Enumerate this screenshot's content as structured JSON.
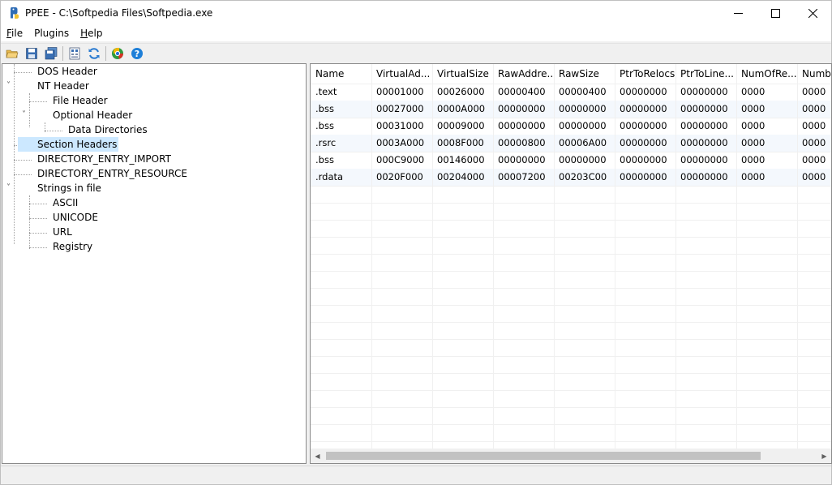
{
  "window": {
    "title": "PPEE - C:\\Softpedia Files\\Softpedia.exe",
    "controls": {
      "minimize": "minimize",
      "maximize": "maximize",
      "close": "close"
    }
  },
  "menu": [
    {
      "key": "F",
      "rest": "ile"
    },
    {
      "key": "",
      "rest": "Plugins"
    },
    {
      "key": "H",
      "rest": "elp"
    }
  ],
  "toolbar": {
    "buttons": [
      "open-folder-icon",
      "save-icon",
      "save-all-icon",
      "hex-view-icon",
      "refresh-icon",
      "plugins-icon",
      "help-icon"
    ]
  },
  "tree": {
    "nodes": [
      {
        "label": "DOS Header",
        "expander": "",
        "selected": false
      },
      {
        "label": "NT Header",
        "expander": "˅",
        "selected": false
      },
      {
        "label": "File Header",
        "expander": "",
        "selected": false
      },
      {
        "label": "Optional Header",
        "expander": "˅",
        "selected": false
      },
      {
        "label": "Data Directories",
        "expander": "",
        "selected": false
      },
      {
        "label": "Section Headers",
        "expander": "",
        "selected": true
      },
      {
        "label": "DIRECTORY_ENTRY_IMPORT",
        "expander": "",
        "selected": false
      },
      {
        "label": "DIRECTORY_ENTRY_RESOURCE",
        "expander": "",
        "selected": false
      },
      {
        "label": "Strings in file",
        "expander": "˅",
        "selected": false
      },
      {
        "label": "ASCII",
        "expander": "",
        "selected": false
      },
      {
        "label": "UNICODE",
        "expander": "",
        "selected": false
      },
      {
        "label": "URL",
        "expander": "",
        "selected": false
      },
      {
        "label": "Registry",
        "expander": "",
        "selected": false
      }
    ]
  },
  "table": {
    "columns": [
      "Name",
      "VirtualAd...",
      "VirtualSize",
      "RawAddre...",
      "RawSize",
      "PtrToRelocs",
      "PtrToLine...",
      "NumOfRe...",
      "NumbO"
    ],
    "rows": [
      [
        ".text",
        "00001000",
        "00026000",
        "00000400",
        "00000400",
        "00000000",
        "00000000",
        "0000",
        "0000"
      ],
      [
        ".bss",
        "00027000",
        "0000A000",
        "00000000",
        "00000000",
        "00000000",
        "00000000",
        "0000",
        "0000"
      ],
      [
        ".bss",
        "00031000",
        "00009000",
        "00000000",
        "00000000",
        "00000000",
        "00000000",
        "0000",
        "0000"
      ],
      [
        ".rsrc",
        "0003A000",
        "0008F000",
        "00000800",
        "00006A00",
        "00000000",
        "00000000",
        "0000",
        "0000"
      ],
      [
        ".bss",
        "000C9000",
        "00146000",
        "00000000",
        "00000000",
        "00000000",
        "00000000",
        "0000",
        "0000"
      ],
      [
        ".rdata",
        "0020F000",
        "00204000",
        "00007200",
        "00203C00",
        "00000000",
        "00000000",
        "0000",
        "0000"
      ]
    ]
  }
}
